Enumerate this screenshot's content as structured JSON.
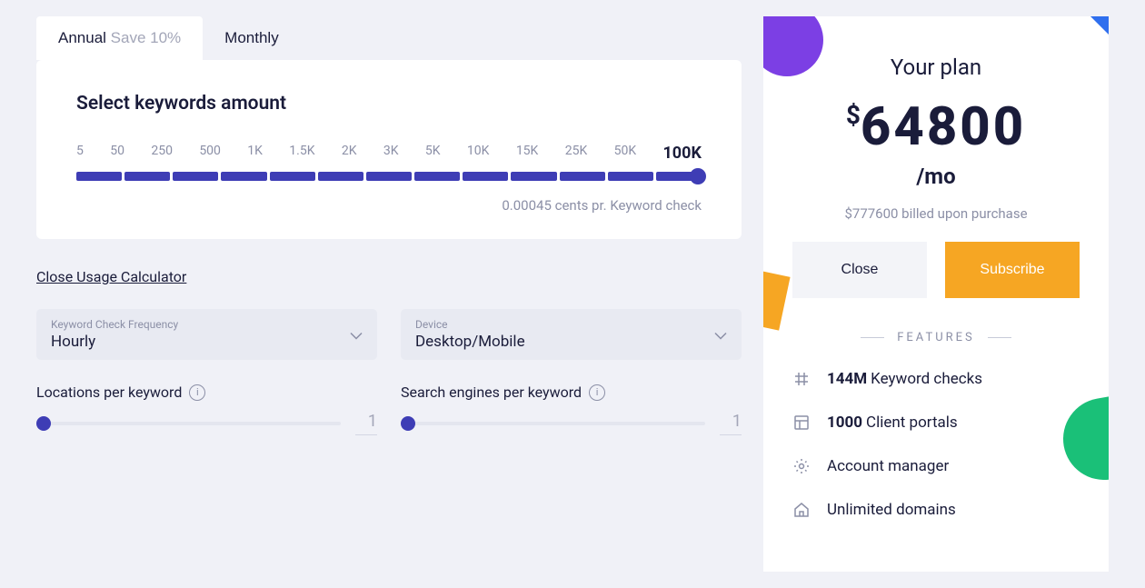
{
  "tabs": {
    "annual": "Annual",
    "annual_save": "Save 10%",
    "monthly": "Monthly"
  },
  "card": {
    "title": "Select keywords amount",
    "labels": [
      "5",
      "50",
      "250",
      "500",
      "1K",
      "1.5K",
      "2K",
      "3K",
      "5K",
      "10K",
      "15K",
      "25K",
      "50K",
      "100K"
    ],
    "price_note": "0.00045 cents pr. Keyword check"
  },
  "close_link": "Close Usage Calculator",
  "selects": {
    "frequency": {
      "label": "Keyword Check Frequency",
      "value": "Hourly"
    },
    "device": {
      "label": "Device",
      "value": "Desktop/Mobile"
    }
  },
  "small_sliders": {
    "locations": {
      "label": "Locations per keyword",
      "value": "1"
    },
    "engines": {
      "label": "Search engines per keyword",
      "value": "1"
    }
  },
  "plan": {
    "title": "Your plan",
    "currency": "$",
    "amount": "64800",
    "period": "/mo",
    "billed": "$777600 billed upon purchase",
    "close_btn": "Close",
    "subscribe_btn": "Subscribe",
    "features_header": "FEATURES",
    "features": [
      {
        "value": "144M",
        "label": "Keyword checks"
      },
      {
        "value": "1000",
        "label": "Client portals"
      },
      {
        "value": "",
        "label": "Account manager"
      },
      {
        "value": "",
        "label": "Unlimited domains"
      }
    ]
  }
}
